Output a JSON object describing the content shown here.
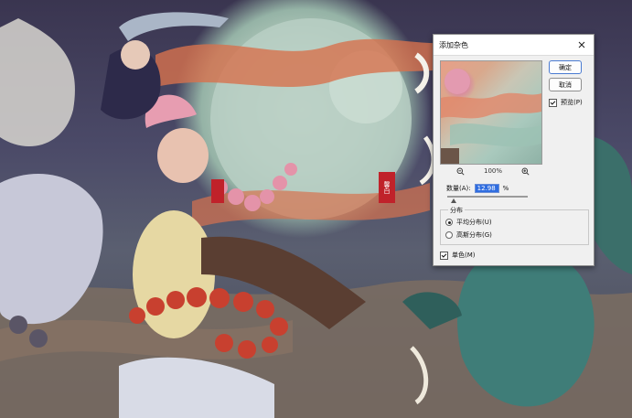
{
  "dialog": {
    "title": "添加杂色",
    "ok_label": "确定",
    "cancel_label": "取消",
    "preview_label": "预览(P)",
    "preview_checked": true,
    "zoom_level": "100%",
    "amount_label": "数量(A):",
    "amount_value": "12.98",
    "amount_unit": "%",
    "distribution_group_label": "分布",
    "uniform_label": "平均分布(U)",
    "gaussian_label": "高斯分布(G)",
    "uniform_selected": true,
    "monochrome_label": "单色(M)",
    "monochrome_checked": true
  },
  "artwork": {
    "seal_text": "馨白"
  },
  "colors": {
    "dialog_bg": "#f0f0f0",
    "accent": "#2f6de0",
    "seal_red": "#c0222a"
  }
}
